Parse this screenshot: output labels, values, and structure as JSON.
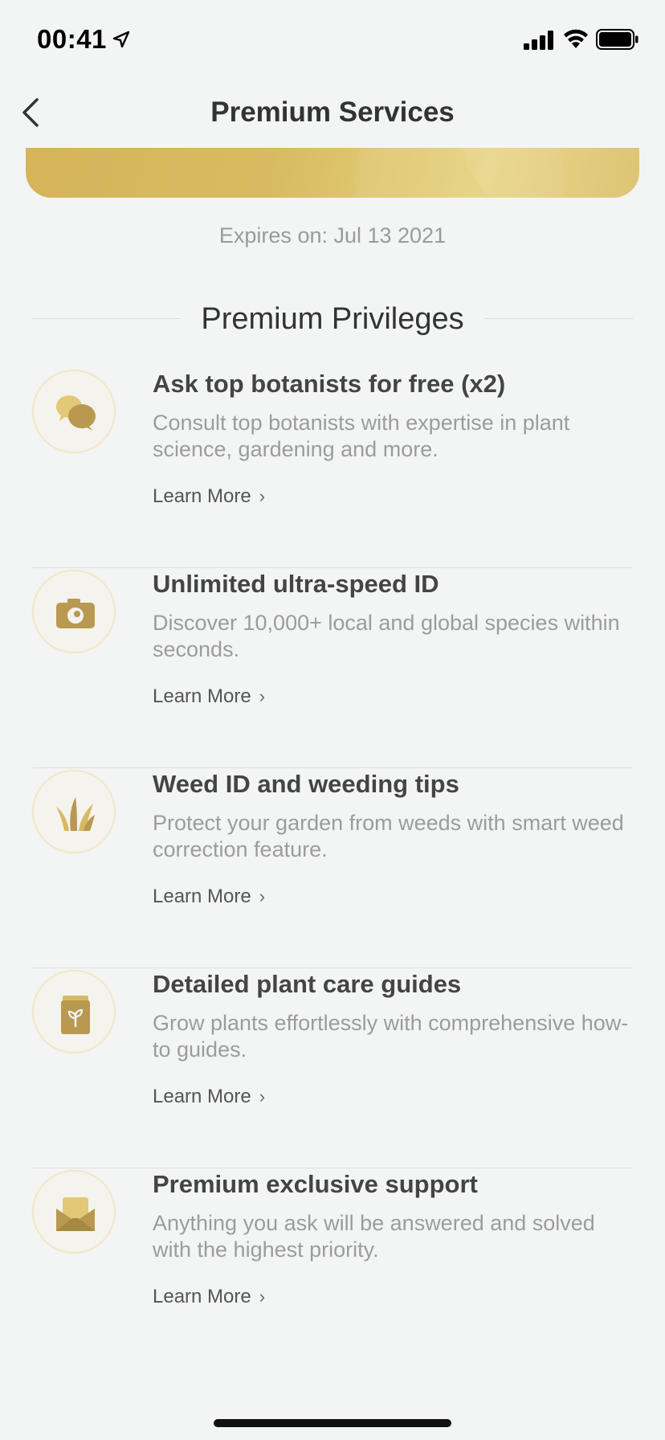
{
  "status_bar": {
    "time": "00:41"
  },
  "nav": {
    "title": "Premium Services"
  },
  "membership": {
    "expires": "Expires on: Jul 13 2021"
  },
  "section": {
    "title": "Premium Privileges"
  },
  "colors": {
    "gold": "#b99a4f",
    "gold_light": "#d8bd68",
    "background": "#f3f5f4"
  },
  "privileges": [
    {
      "icon": "chat-bubbles-icon",
      "title": "Ask top botanists for free (x2)",
      "description": "Consult top botanists with expertise in plant science, gardening and more.",
      "link": "Learn More"
    },
    {
      "icon": "camera-icon",
      "title": "Unlimited ultra-speed ID",
      "description": "Discover 10,000+ local and global species within seconds.",
      "link": "Learn More"
    },
    {
      "icon": "grass-icon",
      "title": "Weed ID and weeding tips",
      "description": "Protect your garden from weeds with smart weed correction feature.",
      "link": "Learn More"
    },
    {
      "icon": "plant-guide-icon",
      "title": "Detailed plant care guides",
      "description": "Grow plants effortlessly with comprehensive how-to guides.",
      "link": "Learn More"
    },
    {
      "icon": "envelope-icon",
      "title": "Premium exclusive support",
      "description": "Anything you ask will be answered and solved with the highest priority.",
      "link": "Learn More"
    }
  ]
}
